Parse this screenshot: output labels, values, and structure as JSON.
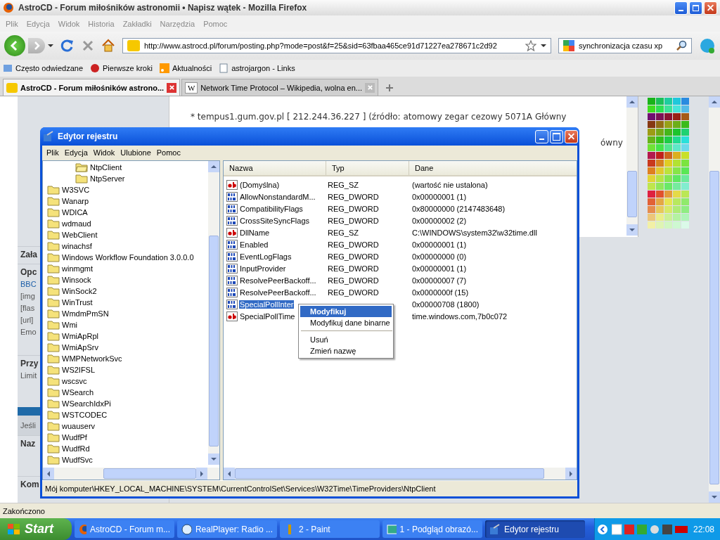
{
  "browser": {
    "title": "AstroCD - Forum miłośników astronomii • Napisz wątek - Mozilla Firefox",
    "menu": [
      "Plik",
      "Edycja",
      "Widok",
      "Historia",
      "Zakładki",
      "Narzędzia",
      "Pomoc"
    ],
    "url": "http://www.astrocd.pl/forum/posting.php?mode=post&f=25&sid=63fbaa465ce91d71227ea278671c2d92",
    "search": "synchronizacja czasu xp",
    "bookmarks": [
      {
        "label": "Często odwiedzane",
        "kind": "smart"
      },
      {
        "label": "Pierwsze kroki",
        "kind": "start"
      },
      {
        "label": "Aktualności",
        "kind": "feed"
      },
      {
        "label": "astrojargon - Links",
        "kind": "page"
      }
    ],
    "tabs": [
      {
        "label": "AstroCD - Forum miłośników astrono...",
        "selected": true
      },
      {
        "label": "Network Time Protocol – Wikipedia, wolna en...",
        "favicon_text": "W",
        "selected": false
      }
    ],
    "status": "Zakończono"
  },
  "page": {
    "sidebar_sections": [
      {
        "items": [
          {
            "text": "Zała",
            "kind": "heading"
          }
        ]
      },
      {
        "items": [
          {
            "text": "Opc",
            "kind": "heading"
          },
          {
            "text": "BBC",
            "kind": "link"
          },
          {
            "text": "[img",
            "kind": "text"
          },
          {
            "text": "[flas",
            "kind": "text"
          },
          {
            "text": "[url]",
            "kind": "text"
          },
          {
            "text": "Emo",
            "kind": "text"
          }
        ]
      },
      {
        "items": [
          {
            "text": "Przy",
            "kind": "heading"
          },
          {
            "text": "Limit",
            "kind": "text"
          }
        ]
      },
      {
        "items": [
          {
            "text": "Jeśli",
            "kind": "text"
          }
        ]
      },
      {
        "items": [
          {
            "text": "Naz",
            "kind": "heading"
          }
        ]
      },
      {
        "items": [
          {
            "text": "Kom",
            "kind": "heading"
          }
        ]
      }
    ],
    "post_lines": [
      "* tempus1.gum.gov.pl [ 212.244.36.227 ] (źródło: atomowy zegar cezowy 5071A Główny",
      "ówny"
    ]
  },
  "regedit": {
    "title": "Edytor rejestru",
    "menu": [
      "Plik",
      "Edycja",
      "Widok",
      "Ulubione",
      "Pomoc"
    ],
    "tree": [
      {
        "children": [
          {
            "children": [
              {
                "label": "NtpClient",
                "selected": true
              },
              {
                "label": "NtpServer",
                "selected": false
              }
            ]
          }
        ]
      },
      {
        "label": "W3SVC",
        "selected": false
      },
      {
        "label": "Wanarp",
        "selected": false
      },
      {
        "label": "WDICA",
        "selected": false
      },
      {
        "label": "wdmaud",
        "selected": false
      },
      {
        "label": "WebClient",
        "selected": false
      },
      {
        "label": "winachsf",
        "selected": false
      },
      {
        "label": "Windows Workflow Foundation 3.0.0.0",
        "selected": false
      },
      {
        "label": "winmgmt",
        "selected": false
      },
      {
        "label": "Winsock",
        "selected": false
      },
      {
        "label": "WinSock2",
        "selected": false
      },
      {
        "label": "WinTrust",
        "selected": false
      },
      {
        "label": "WmdmPmSN",
        "selected": false
      },
      {
        "label": "Wmi",
        "selected": false
      },
      {
        "label": "WmiApRpl",
        "selected": false
      },
      {
        "label": "WmiApSrv",
        "selected": false
      },
      {
        "label": "WMPNetworkSvc",
        "selected": false
      },
      {
        "label": "WS2IFSL",
        "selected": false
      },
      {
        "label": "wscsvc",
        "selected": false
      },
      {
        "label": "WSearch",
        "selected": false
      },
      {
        "label": "WSearchIdxPi",
        "selected": false
      },
      {
        "label": "WSTCODEC",
        "selected": false
      },
      {
        "label": "wuauserv",
        "selected": false
      },
      {
        "label": "WudfPf",
        "selected": false
      },
      {
        "label": "WudfRd",
        "selected": false
      },
      {
        "label": "WudfSvc",
        "selected": false
      }
    ],
    "columns": [
      "Nazwa",
      "Typ",
      "Dane"
    ],
    "rows": [
      {
        "name": "(Domyślna)",
        "type": "REG_SZ",
        "data": "(wartość nie ustalona)",
        "kind": "string",
        "selected": false
      },
      {
        "name": "AllowNonstandardM...",
        "type": "REG_DWORD",
        "data": "0x00000001 (1)",
        "kind": "dword",
        "selected": false
      },
      {
        "name": "CompatibilityFlags",
        "type": "REG_DWORD",
        "data": "0x80000000 (2147483648)",
        "kind": "dword",
        "selected": false
      },
      {
        "name": "CrossSiteSyncFlags",
        "type": "REG_DWORD",
        "data": "0x00000002 (2)",
        "kind": "dword",
        "selected": false
      },
      {
        "name": "DllName",
        "type": "REG_SZ",
        "data": "C:\\WINDOWS\\system32\\w32time.dll",
        "kind": "string",
        "selected": false
      },
      {
        "name": "Enabled",
        "type": "REG_DWORD",
        "data": "0x00000001 (1)",
        "kind": "dword",
        "selected": false
      },
      {
        "name": "EventLogFlags",
        "type": "REG_DWORD",
        "data": "0x00000000 (0)",
        "kind": "dword",
        "selected": false
      },
      {
        "name": "InputProvider",
        "type": "REG_DWORD",
        "data": "0x00000001 (1)",
        "kind": "dword",
        "selected": false
      },
      {
        "name": "ResolvePeerBackoff...",
        "type": "REG_DWORD",
        "data": "0x00000007 (7)",
        "kind": "dword",
        "selected": false
      },
      {
        "name": "ResolvePeerBackoff...",
        "type": "REG_DWORD",
        "data": "0x0000000f (15)",
        "kind": "dword",
        "selected": false
      },
      {
        "name": "SpecialPollInter",
        "data": "0x00000708 (1800)",
        "kind": "dword",
        "selected": true
      },
      {
        "name": "SpecialPollTime",
        "data": "time.windows.com,7b0c072",
        "kind": "string",
        "selected": false
      }
    ],
    "context_menu": [
      {
        "label": "Modyfikuj",
        "kind": "item",
        "selected": true
      },
      {
        "label": "Modyfikuj dane binarne",
        "kind": "item",
        "selected": false
      },
      {
        "kind": "separator"
      },
      {
        "label": "Usuń",
        "kind": "item",
        "selected": false
      },
      {
        "label": "Zmień nazwę",
        "kind": "item",
        "selected": false
      }
    ],
    "status": "Mój komputer\\HKEY_LOCAL_MACHINE\\SYSTEM\\CurrentControlSet\\Services\\W32Time\\TimeProviders\\NtpClient"
  },
  "taskbar": {
    "start": "Start",
    "tasks": [
      {
        "label": "AstroCD - Forum m...",
        "kind": "firefox",
        "selected": false
      },
      {
        "label": "RealPlayer: Radio ...",
        "kind": "realplayer",
        "selected": false
      },
      {
        "label": "2 - Paint",
        "kind": "paint",
        "selected": false
      },
      {
        "label": "1 - Podgląd obrazó...",
        "kind": "viewer",
        "selected": false
      },
      {
        "label": "Edytor rejestru",
        "kind": "regedit",
        "selected": true
      }
    ],
    "clock": "22:08"
  }
}
